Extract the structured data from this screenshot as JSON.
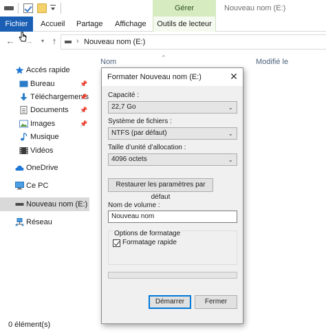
{
  "titlebar": {
    "window_title": "Nouveau nom (E:)",
    "context_group": "Gérer"
  },
  "ribbon": {
    "tabs": [
      "Fichier",
      "Accueil",
      "Partage",
      "Affichage",
      "Outils de lecteur"
    ],
    "active_tab": "Fichier",
    "accent_color": "#1a5fb4",
    "context_color": "#d7ebc1"
  },
  "address": {
    "path": "Nouveau nom (E:)",
    "chevron": "›"
  },
  "columns": {
    "name": "Nom",
    "modified": "Modifié le"
  },
  "sidebar": {
    "items": [
      {
        "label": "Accès rapide",
        "icon": "star-icon",
        "pinned": false
      },
      {
        "label": "Bureau",
        "icon": "desktop-icon",
        "pinned": true
      },
      {
        "label": "Téléchargements",
        "icon": "download-icon",
        "pinned": true
      },
      {
        "label": "Documents",
        "icon": "documents-icon",
        "pinned": true
      },
      {
        "label": "Images",
        "icon": "images-icon",
        "pinned": true
      },
      {
        "label": "Musique",
        "icon": "music-icon",
        "pinned": false
      },
      {
        "label": "Vidéos",
        "icon": "videos-icon",
        "pinned": false
      },
      {
        "label": "OneDrive",
        "icon": "cloud-icon",
        "pinned": false
      },
      {
        "label": "Ce PC",
        "icon": "computer-icon",
        "pinned": false
      },
      {
        "label": "Nouveau nom (E:)",
        "icon": "drive-icon",
        "pinned": false,
        "selected": true
      },
      {
        "label": "Réseau",
        "icon": "network-icon",
        "pinned": false
      }
    ]
  },
  "status": {
    "text": "0 élément(s)"
  },
  "dialog": {
    "title": "Formater Nouveau nom (E:)",
    "close_glyph": "✕",
    "capacity": {
      "label": "Capacité :",
      "value": "22,7 Go"
    },
    "filesystem": {
      "label": "Système de fichiers :",
      "value": "NTFS (par défaut)"
    },
    "allocation": {
      "label": "Taille d’unité d’allocation :",
      "value": "4096 octets"
    },
    "restore_button": "Restaurer les paramètres par défaut",
    "volume": {
      "label": "Nom de volume :",
      "value": "Nouveau nom"
    },
    "options": {
      "title": "Options de formatage",
      "quick_format_label": "Formatage rapide",
      "quick_format_checked": true
    },
    "progress": 0,
    "start_button": "Démarrer",
    "close_button": "Fermer"
  }
}
